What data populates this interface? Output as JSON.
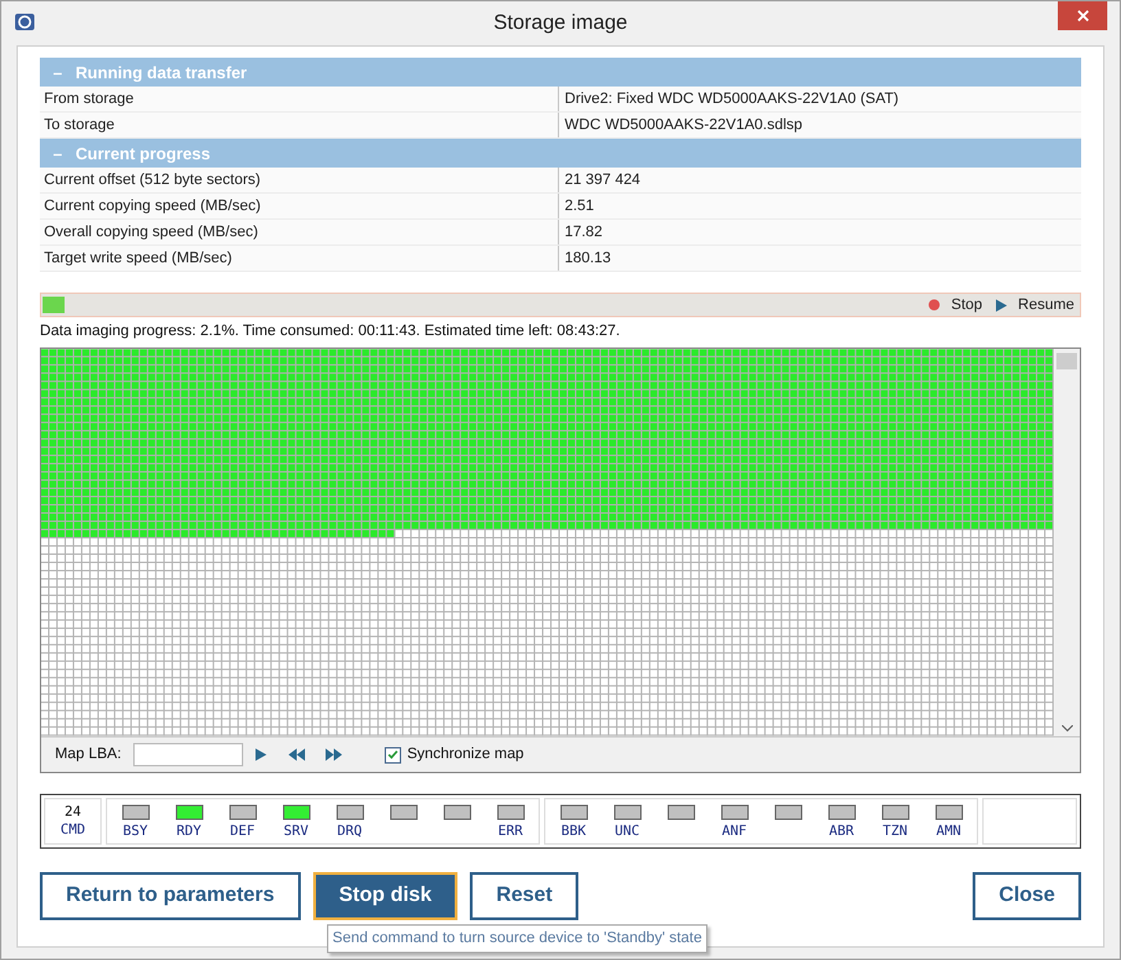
{
  "window": {
    "title": "Storage image"
  },
  "sections": [
    {
      "title": "Running data transfer",
      "expanded": true,
      "rows": [
        {
          "label": "From storage",
          "value": "Drive2: Fixed WDC WD5000AAKS-22V1A0 (SAT)"
        },
        {
          "label": "To storage",
          "value": "WDC WD5000AAKS-22V1A0.sdlsp"
        }
      ]
    },
    {
      "title": "Current progress",
      "expanded": true,
      "rows": [
        {
          "label": "Current offset (512 byte sectors)",
          "value": "21 397 424"
        },
        {
          "label": "Current copying speed (MB/sec)",
          "value": "2.51"
        },
        {
          "label": "Overall copying speed (MB/sec)",
          "value": "17.82"
        },
        {
          "label": "Target write speed (MB/sec)",
          "value": "180.13"
        }
      ]
    }
  ],
  "collapse_glyph": "–",
  "progress": {
    "level": 0.021,
    "stop_label": "Stop",
    "resume_label": "Resume",
    "status": "Data imaging progress: 2.1%. Time consumed: 00:11:43. Estimated time left: 08:43:27."
  },
  "map_controls": {
    "label": "Map LBA:",
    "synchronize": {
      "label": "Synchronize map",
      "checked": true
    }
  },
  "cmd": {
    "value": "24",
    "label": "CMD"
  },
  "led_groups": [
    [
      {
        "label": "BSY",
        "on": false
      },
      {
        "label": "RDY",
        "on": true
      },
      {
        "label": "DEF",
        "on": false
      },
      {
        "label": "SRV",
        "on": true
      },
      {
        "label": "DRQ",
        "on": false
      },
      {
        "on": false
      },
      {
        "on": false
      },
      {
        "label": "ERR",
        "on": false
      }
    ],
    [
      {
        "label": "BBK",
        "on": false
      },
      {
        "label": "UNC",
        "on": false
      },
      {
        "on": false
      },
      {
        "label": "ANF",
        "on": false
      },
      {
        "on": false
      },
      {
        "label": "ABR",
        "on": false
      },
      {
        "label": "TZN",
        "on": false
      },
      {
        "label": "AMN",
        "on": false
      }
    ]
  ],
  "buttons": [
    {
      "label": "Return to parameters",
      "selected": false
    },
    {
      "label": "Stop disk",
      "selected": true
    },
    {
      "label": "Reset",
      "selected": false
    }
  ],
  "close_button": "Close",
  "tooltip": "Send command to turn source device to 'Standby' state"
}
